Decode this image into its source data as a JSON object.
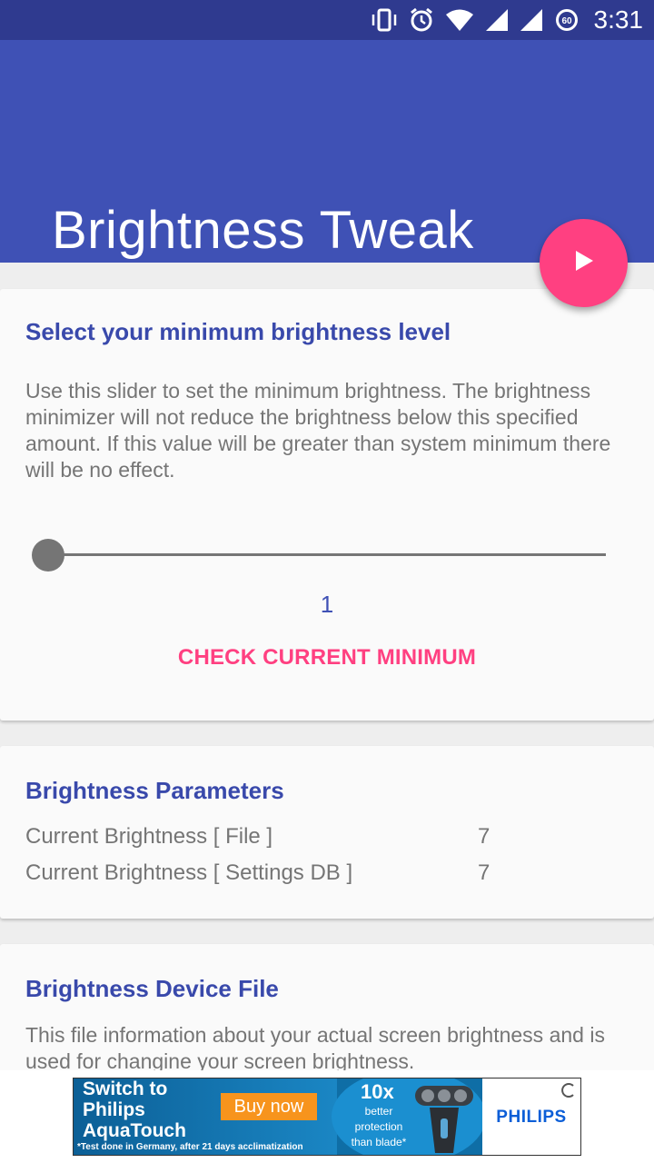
{
  "status_bar": {
    "time": "3:31",
    "battery_level": "60",
    "icons": [
      "vibrate-icon",
      "alarm-icon",
      "wifi-icon",
      "signal-icon",
      "signal-icon",
      "battery-saver-icon"
    ]
  },
  "app_bar": {
    "title": "Brightness Tweak",
    "fab_icon": "play-icon",
    "color": "#3f51b5",
    "accent": "#ff4081"
  },
  "min_brightness_card": {
    "title": "Select your minimum brightness level",
    "description": "Use this slider to set the minimum brightness. The brightness minimizer will not reduce the brightness below this specified amount. If this value will be greater than system minimum there will be no effect.",
    "slider_value": "1",
    "check_button_label": "CHECK CURRENT MINIMUM"
  },
  "parameters_card": {
    "title": "Brightness Parameters",
    "rows": [
      {
        "label": "Current Brightness [ File ]",
        "value": "7"
      },
      {
        "label": "Current Brightness [ Settings DB ]",
        "value": "7"
      }
    ]
  },
  "device_file_card": {
    "title": "Brightness Device File",
    "description": "This file information about your actual screen brightness and is used for changine your screen brightness."
  },
  "ad": {
    "headline": "Switch to\nPhilips\nAquaTouch",
    "buy_label": "Buy now",
    "claim_big": "10x",
    "claim_small": "better\nprotection\nthan blade*",
    "disclaimer": "*Test done in Germany, after 21 days acclimatization",
    "brand": "PHILIPS"
  }
}
